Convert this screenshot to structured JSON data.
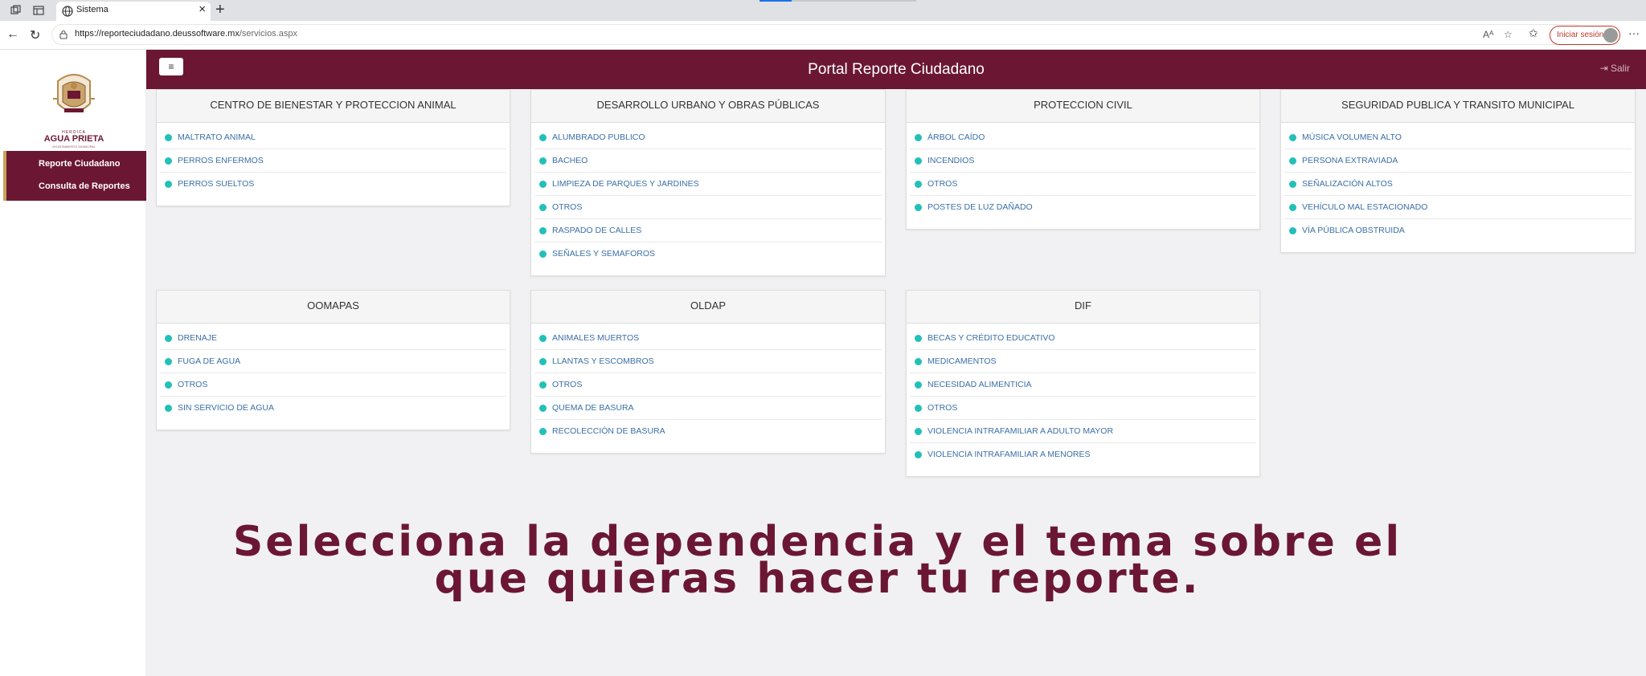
{
  "browser": {
    "tab_title": "Sistema",
    "url_host": "https://reporteciudadano.deussoftware.mx",
    "url_path": "/servicios.aspx",
    "signin_label": "Iniciar sesión",
    "icons": [
      "back-icon",
      "refresh-icon",
      "lock-icon",
      "read-aloud-icon",
      "favorite-icon",
      "collections-icon",
      "more-icon"
    ]
  },
  "sidebar": {
    "logo_top": "HEROICA",
    "logo_name": "AGUA PRIETA",
    "logo_sub": "AYUNTAMIENTO MUNICIPAL",
    "items": [
      {
        "label": "Reporte Ciudadano"
      },
      {
        "label": "Consulta de Reportes"
      }
    ]
  },
  "header": {
    "menu_icon": "≡",
    "title": "Portal Reporte Ciudadano",
    "logout_label": "Salir"
  },
  "cards": [
    {
      "title": "CENTRO DE BIENESTAR Y PROTECCION ANIMAL",
      "items": [
        "MALTRATO ANIMAL",
        "PERROS ENFERMOS",
        "PERROS SUELTOS"
      ]
    },
    {
      "title": "DESARROLLO URBANO Y OBRAS PÚBLICAS",
      "items": [
        "ALUMBRADO PUBLICO",
        "BACHEO",
        "LIMPIEZA DE PARQUES Y JARDINES",
        "OTROS",
        "RASPADO DE CALLES",
        "SEÑALES Y SEMAFOROS"
      ]
    },
    {
      "title": "PROTECCION CIVIL",
      "items": [
        "ÁRBOL CAÍDO",
        "INCENDIOS",
        "OTROS",
        "POSTES DE LUZ DAÑADO"
      ]
    },
    {
      "title": "SEGURIDAD PUBLICA Y TRANSITO MUNICIPAL",
      "items": [
        "MÚSICA VOLUMEN ALTO",
        "PERSONA EXTRAVIADA",
        "SEÑALIZACIÓN ALTOS",
        "VEHÍCULO MAL ESTACIONADO",
        "VÍA PÚBLICA OBSTRUIDA"
      ]
    },
    {
      "title": "OOMAPAS",
      "items": [
        "DRENAJE",
        "FUGA DE AGUA",
        "OTROS",
        "SIN SERVICIO DE AGUA"
      ]
    },
    {
      "title": "OLDAP",
      "items": [
        "ANIMALES MUERTOS",
        "LLANTAS Y ESCOMBROS",
        "OTROS",
        "QUEMA DE BASURA",
        "RECOLECCIÓN DE BASURA"
      ]
    },
    {
      "title": "DIF",
      "items": [
        "BECAS Y CRÉDITO EDUCATIVO",
        "MEDICAMENTOS",
        "NECESIDAD ALIMENTICIA",
        "OTROS",
        "VIOLENCIA INTRAFAMILIAR A ADULTO MAYOR",
        "VIOLENCIA INTRAFAMILIAR A MENORES"
      ]
    }
  ],
  "caption": {
    "line1": "Selecciona la dependencia y el tema sobre el",
    "line2": "que quieras hacer tu reporte."
  },
  "colors": {
    "brand": "#6b1733",
    "bullet": "#22c0b8",
    "link": "#3b6fa7"
  }
}
